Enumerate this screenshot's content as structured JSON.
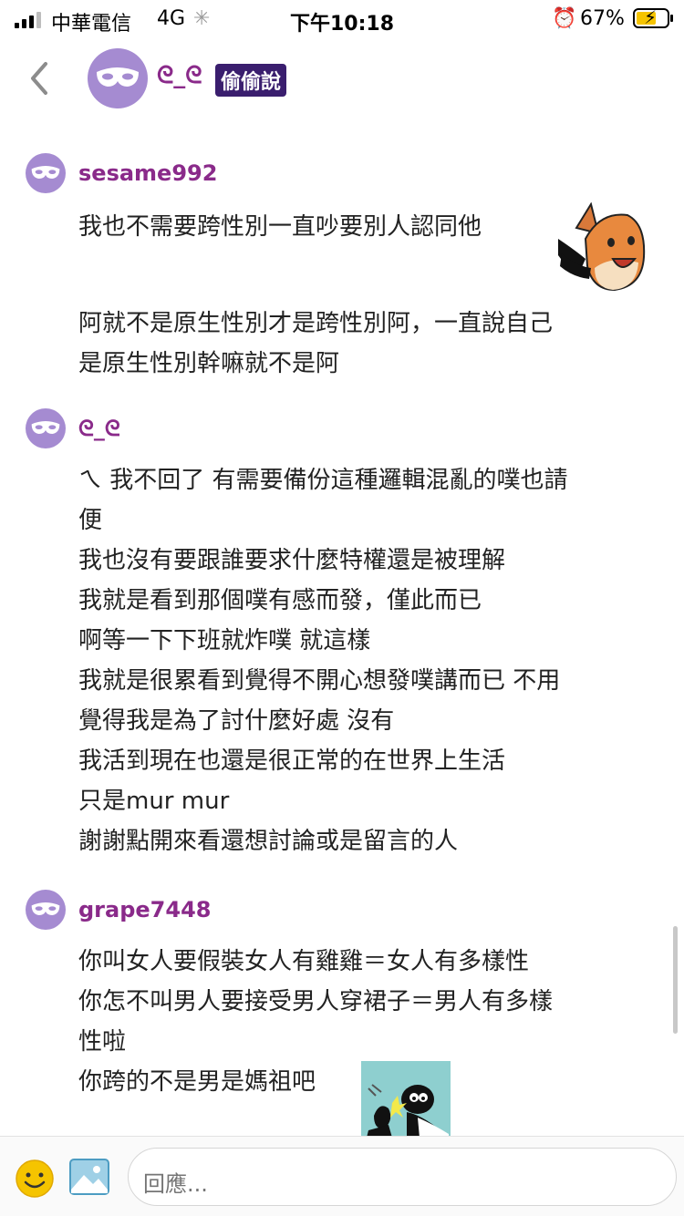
{
  "status_bar": {
    "carrier": "中華電信",
    "network": "4G",
    "time": "下午10:18",
    "battery_percent": "67%",
    "battery_level": 0.67
  },
  "header": {
    "username": "ᘓ_ᘓ",
    "tag": "偷偷說"
  },
  "responses": [
    {
      "username": "sesame992",
      "lines": [
        "我也不需要跨性別一直吵要別人認同他",
        "阿就不是原生性別才是跨性別阿，一直說自己",
        "是原生性別幹嘛就不是阿"
      ],
      "sticker": "fox-sticker"
    },
    {
      "username": "ᘓ_ᘓ",
      "lines": [
        "ㄟ 我不回了 有需要備份這種邏輯混亂的噗也請",
        "便",
        "我也沒有要跟誰要求什麼特權還是被理解",
        "我就是看到那個噗有感而發，僅此而已",
        "啊等一下下班就炸噗 就這樣",
        "我就是很累看到覺得不開心想發噗講而已 不用",
        "覺得我是為了討什麼好處 沒有",
        "我活到現在也還是很正常的在世界上生活",
        "只是mur mur",
        "謝謝點開來看還想討論或是留言的人"
      ]
    },
    {
      "username": "grape7448",
      "lines": [
        "你叫女人要假裝女人有雞雞＝女人有多樣性",
        "你怎不叫男人要接受男人穿裙子＝男人有多樣",
        "性啦",
        "你跨的不是男是媽祖吧"
      ],
      "sticker": "fight-sticker"
    }
  ],
  "reply": {
    "placeholder": "回應..."
  },
  "colors": {
    "username": "#8a2a8a",
    "avatar": "#a58bd1",
    "tag_bg": "#3a1e6e"
  }
}
